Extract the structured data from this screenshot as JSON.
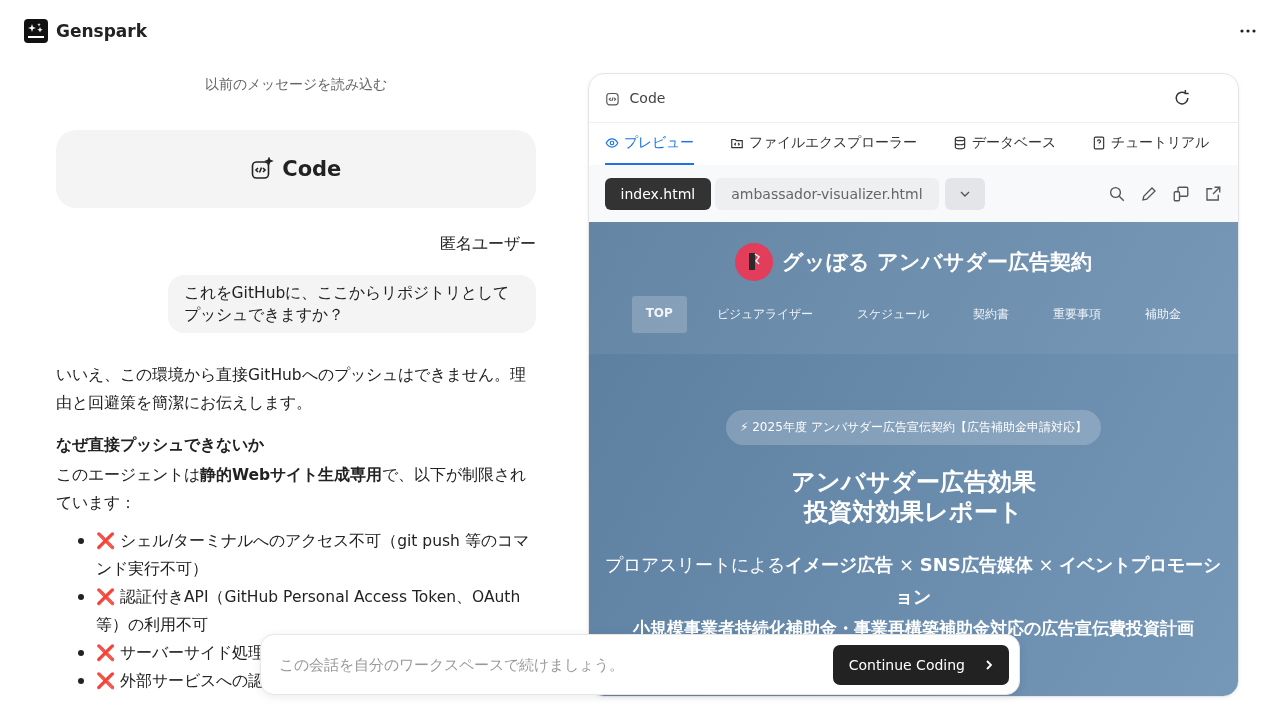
{
  "header": {
    "brand": "Genspark"
  },
  "chat": {
    "load_more": "以前のメッセージを読み込む",
    "code_card": "Code",
    "user_name": "匿名ユーザー",
    "user_message": "これをGitHubに、ここからリポジトリとしてプッシュできますか？",
    "intro": "いいえ、この環境から直接GitHubへのプッシュはできません。理由と回避策を簡潔にお伝えします。",
    "heading": "なぜ直接プッシュできないか",
    "paragraph": "このエージェントは**静的Webサイト生成専用**で、以下が制限されています：",
    "bullets": [
      {
        "mark": "❌",
        "text": "シェル/ターミナルへのアクセス不可（git push 等のコマンド実行不可）"
      },
      {
        "mark": "❌",
        "text": "認証付きAPI（GitHub Personal Access Token、OAuth等）の利用不可"
      },
      {
        "mark": "❌",
        "text": "サーバーサイド処理"
      },
      {
        "mark": "❌",
        "text": "外部サービスへの認"
      }
    ]
  },
  "panel": {
    "title": "Code",
    "tabs": [
      {
        "label": "プレビュー",
        "selected": true
      },
      {
        "label": "ファイルエクスプローラー",
        "selected": false
      },
      {
        "label": "データベース",
        "selected": false
      },
      {
        "label": "チュートリアル",
        "selected": false
      }
    ],
    "files": [
      {
        "label": "index.html",
        "selected": true
      },
      {
        "label": "ambassador-visualizer.html",
        "selected": false
      }
    ],
    "preview": {
      "site_title": "グッぼる アンバサダー広告契約",
      "nav": [
        {
          "label": "TOP",
          "selected": true
        },
        {
          "label": "ビジュアライザー",
          "selected": false
        },
        {
          "label": "スケジュール",
          "selected": false
        },
        {
          "label": "契約書",
          "selected": false
        },
        {
          "label": "重要事項",
          "selected": false
        },
        {
          "label": "補助金",
          "selected": false
        }
      ],
      "badge": "⚡ 2025年度 アンバサダー広告宣伝契約【広告補助金申請対応】",
      "hero_title": [
        "アンバサダー広告効果",
        "投資対効果レポート"
      ],
      "subtitle": "プロアスリートによる**イメージ広告** × **SNS広告媒体** × **イベントプロモーション**",
      "subtitle_2": "小規模事業者持続化補助金・事業再構築補助金対応の広告宣伝費投資計画"
    }
  },
  "prompt": {
    "placeholder": "この会話を自分のワークスペースで続けましょう。",
    "button": "Continue Coding"
  }
}
